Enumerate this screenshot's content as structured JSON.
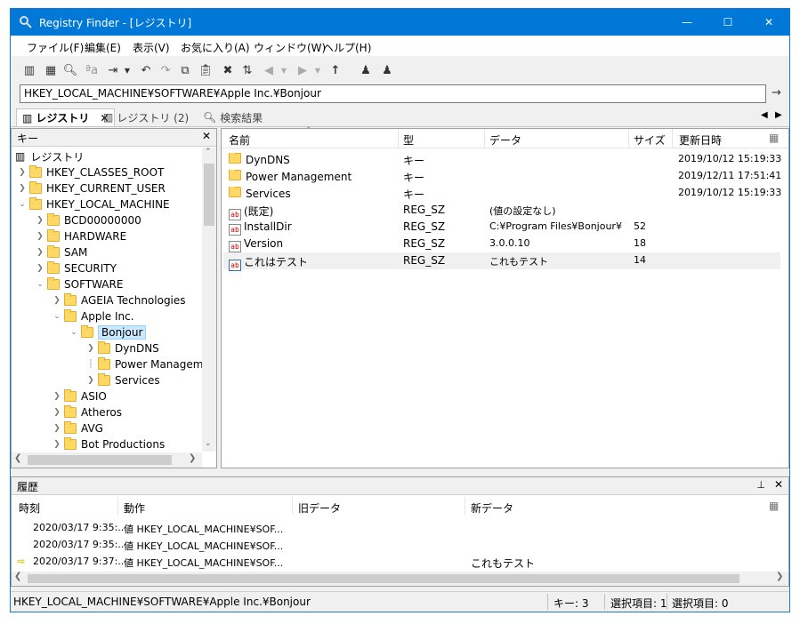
{
  "window": {
    "title": "Registry Finder - [レジストリ]",
    "minimize": "—",
    "maximize": "☐",
    "close": "✕"
  },
  "menu": [
    "ファイル(F)",
    "編集(E)",
    "表示(V)",
    "お気に入り(A)",
    "ウィンドウ(W)",
    "ヘルプ(H)"
  ],
  "address": {
    "value": "HKEY_LOCAL_MACHINE¥SOFTWARE¥Apple Inc.¥Bonjour",
    "go": "→"
  },
  "tabs": [
    {
      "label": "レジストリ",
      "close": "✕"
    },
    {
      "label": "レジストリ (2)"
    },
    {
      "label": "検索結果"
    }
  ],
  "tree": {
    "header": "キー",
    "close": "✕",
    "root": "レジストリ",
    "nodes": [
      "HKEY_CLASSES_ROOT",
      "HKEY_CURRENT_USER",
      "HKEY_LOCAL_MACHINE",
      "BCD00000000",
      "HARDWARE",
      "SAM",
      "SECURITY",
      "SOFTWARE",
      "AGEIA Technologies",
      "Apple Inc.",
      "Bonjour",
      "DynDNS",
      "Power Manageme",
      "Services",
      "ASIO",
      "Atheros",
      "AVG",
      "Bot Productions"
    ]
  },
  "list": {
    "columns": [
      "名前",
      "型",
      "データ",
      "サイズ",
      "更新日時"
    ],
    "rows": [
      {
        "name": "DynDNS",
        "type": "キー",
        "data": "",
        "size": "",
        "date": "2019/10/12 15:19:33",
        "kind": "folder"
      },
      {
        "name": "Power Management",
        "type": "キー",
        "data": "",
        "size": "",
        "date": "2019/12/11 17:51:41",
        "kind": "folder"
      },
      {
        "name": "Services",
        "type": "キー",
        "data": "",
        "size": "",
        "date": "2019/10/12 15:19:33",
        "kind": "folder"
      },
      {
        "name": "(既定)",
        "type": "REG_SZ",
        "data": "(値の設定なし)",
        "size": "",
        "date": "",
        "kind": "string"
      },
      {
        "name": "InstallDir",
        "type": "REG_SZ",
        "data": "C:¥Program Files¥Bonjour¥",
        "size": "52",
        "date": "",
        "kind": "string"
      },
      {
        "name": "Version",
        "type": "REG_SZ",
        "data": "3.0.0.10",
        "size": "18",
        "date": "",
        "kind": "string"
      },
      {
        "name": "これはテスト",
        "type": "REG_SZ",
        "data": "これもテスト",
        "size": "14",
        "date": "",
        "kind": "string"
      }
    ],
    "string_icon": "ab"
  },
  "history": {
    "title": "履歴",
    "pin": "📌",
    "close": "✕",
    "columns": [
      "時刻",
      "動作",
      "旧データ",
      "新データ"
    ],
    "rows": [
      {
        "time": "2020/03/17 9:35:...",
        "action": "値 HKEY_LOCAL_MACHINE¥SOF...",
        "old": "",
        "new": ""
      },
      {
        "time": "2020/03/17 9:35:...",
        "action": "値 HKEY_LOCAL_MACHINE¥SOF...",
        "old": "",
        "new": ""
      },
      {
        "time": "2020/03/17 9:37:...",
        "action": "値 HKEY_LOCAL_MACHINE¥SOF...",
        "old": "",
        "new": "これもテスト"
      }
    ],
    "current_marker": "⇨"
  },
  "status": {
    "path": "HKEY_LOCAL_MACHINE¥SOFTWARE¥Apple Inc.¥Bonjour",
    "keys": "キー: 3",
    "selected1": "選択項目: 1",
    "selected0": "選択項目: 0"
  },
  "colors": {
    "titlebar": "#0078d7",
    "folder": "#ffd866",
    "selection": "#cce8ff"
  }
}
